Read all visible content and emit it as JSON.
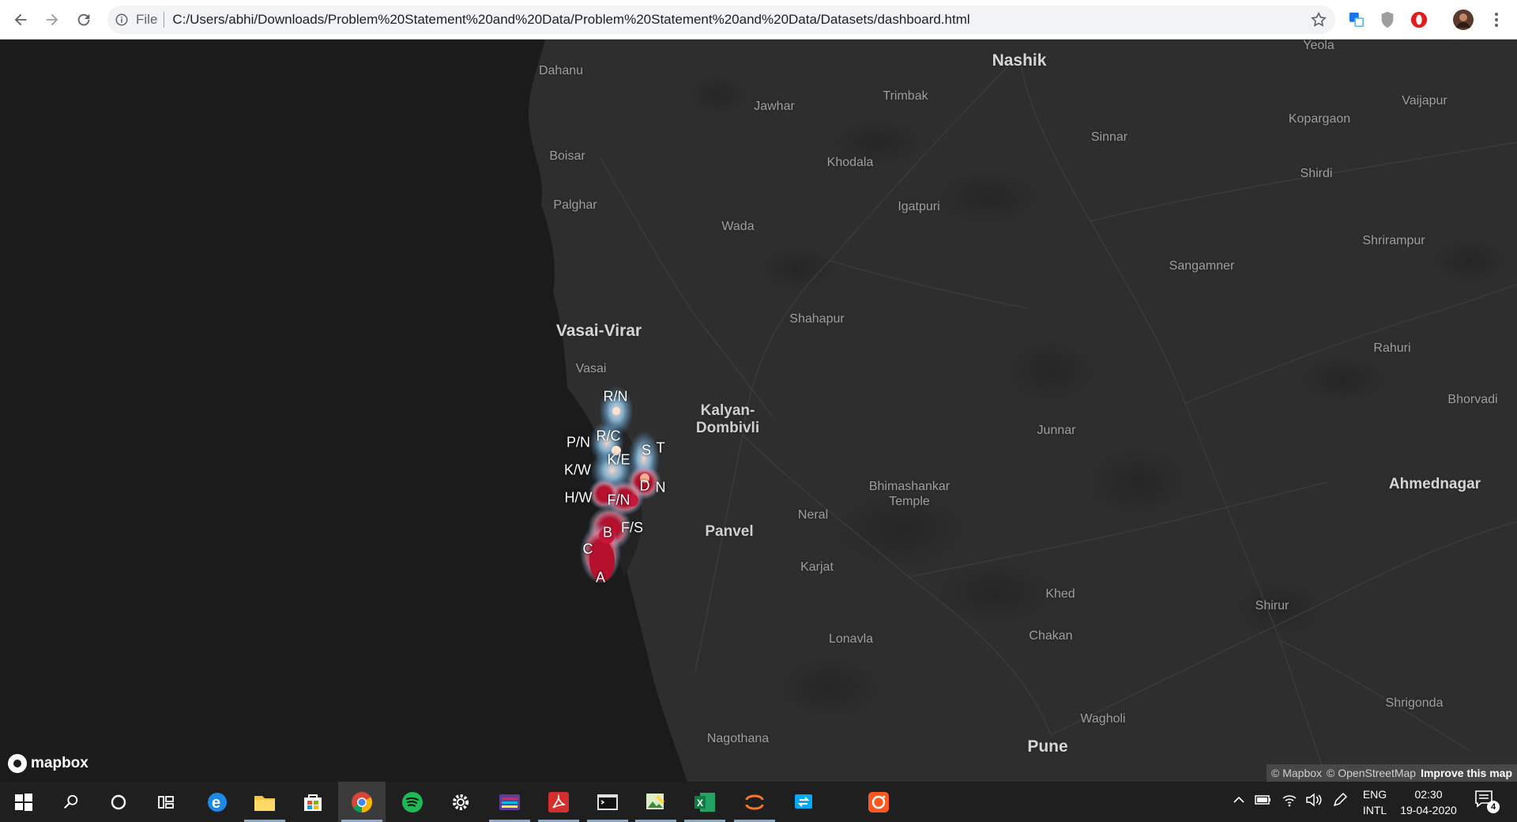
{
  "browser": {
    "scheme_label": "File",
    "url": "C:/Users/abhi/Downloads/Problem%20Statement%20and%20Data/Problem%20Statement%20and%20Data/Datasets/dashboard.html",
    "nav_icons": [
      "back-arrow-icon",
      "forward-arrow-icon",
      "reload-icon"
    ],
    "extensions": [
      "translate-extension-icon",
      "shield-extension-icon",
      "opera-extension-icon",
      "profile-avatar",
      "menu-kebab-icon"
    ]
  },
  "map": {
    "places": [
      {
        "name": "Yeola",
        "style": "minor"
      },
      {
        "name": "Dahanu",
        "style": "minor"
      },
      {
        "name": "Nashik",
        "style": "major"
      },
      {
        "name": "Vaijapur",
        "style": "minor"
      },
      {
        "name": "Jawhar",
        "style": "minor"
      },
      {
        "name": "Trimbak",
        "style": "minor"
      },
      {
        "name": "Kopargaon",
        "style": "minor"
      },
      {
        "name": "Boisar",
        "style": "minor"
      },
      {
        "name": "Sinnar",
        "style": "minor"
      },
      {
        "name": "Khodala",
        "style": "minor"
      },
      {
        "name": "Shirdi",
        "style": "minor"
      },
      {
        "name": "Palghar",
        "style": "minor"
      },
      {
        "name": "Igatpuri",
        "style": "minor"
      },
      {
        "name": "Wada",
        "style": "minor"
      },
      {
        "name": "Shrirampur",
        "style": "minor"
      },
      {
        "name": "Sangamner",
        "style": "minor"
      },
      {
        "name": "Shahapur",
        "style": "minor"
      },
      {
        "name": "Vasai-Virar",
        "style": "major"
      },
      {
        "name": "Rahuri",
        "style": "minor"
      },
      {
        "name": "Vasai",
        "style": "minor"
      },
      {
        "name": "Bhorvadi",
        "style": "minor"
      },
      {
        "name": "Kalyan-\nDombivli",
        "style": "city"
      },
      {
        "name": "Junnar",
        "style": "minor"
      },
      {
        "name": "Bhimashankar\nTemple",
        "style": "minor"
      },
      {
        "name": "Ahmednagar",
        "style": "major"
      },
      {
        "name": "Neral",
        "style": "minor"
      },
      {
        "name": "Panvel",
        "style": "city"
      },
      {
        "name": "Karjat",
        "style": "minor"
      },
      {
        "name": "Khed",
        "style": "minor"
      },
      {
        "name": "Shirur",
        "style": "minor"
      },
      {
        "name": "Lonavla",
        "style": "minor"
      },
      {
        "name": "Chakan",
        "style": "minor"
      },
      {
        "name": "Shrigonda",
        "style": "minor"
      },
      {
        "name": "Wagholi",
        "style": "minor"
      },
      {
        "name": "Nagothana",
        "style": "minor"
      },
      {
        "name": "Pune",
        "style": "major"
      }
    ],
    "wards": [
      {
        "label": "R/N",
        "intensity": 0.3
      },
      {
        "label": "R/C",
        "intensity": 0.55
      },
      {
        "label": "P/N",
        "intensity": 0.65
      },
      {
        "label": "K/E",
        "intensity": 0.7
      },
      {
        "label": "S",
        "intensity": 0.5
      },
      {
        "label": "T",
        "intensity": 0.35
      },
      {
        "label": "K/W",
        "intensity": 0.75
      },
      {
        "label": "D",
        "intensity": 0.6
      },
      {
        "label": "N",
        "intensity": 0.55
      },
      {
        "label": "H/W",
        "intensity": 0.8
      },
      {
        "label": "F/N",
        "intensity": 0.7
      },
      {
        "label": "F/S",
        "intensity": 0.6
      },
      {
        "label": "B",
        "intensity": 1.0
      },
      {
        "label": "C",
        "intensity": 0.9
      },
      {
        "label": "A",
        "intensity": 0.5
      }
    ],
    "logo_label": "mapbox",
    "attribution": [
      "© Mapbox",
      "© OpenStreetMap"
    ],
    "improve_label": "Improve this map"
  },
  "taskbar": {
    "apps": [
      "windows-start-icon",
      "search-icon",
      "cortana-icon",
      "task-view-icon",
      "edge-icon",
      "file-explorer-icon",
      "store-icon",
      "chrome-icon",
      "spotify-icon",
      "settings-icon",
      "app-icon",
      "acrobat-icon",
      "terminal-icon",
      "photos-icon",
      "excel-icon",
      "jupyter-icon",
      "snip-icon",
      "camera-app-icon"
    ],
    "lang_top": "ENG",
    "lang_bottom": "INTL",
    "time": "02:30",
    "date": "19-04-2020",
    "notification_count": "4",
    "colors": {
      "background": "#1f1f1f",
      "active": "#3b3b3b"
    }
  }
}
